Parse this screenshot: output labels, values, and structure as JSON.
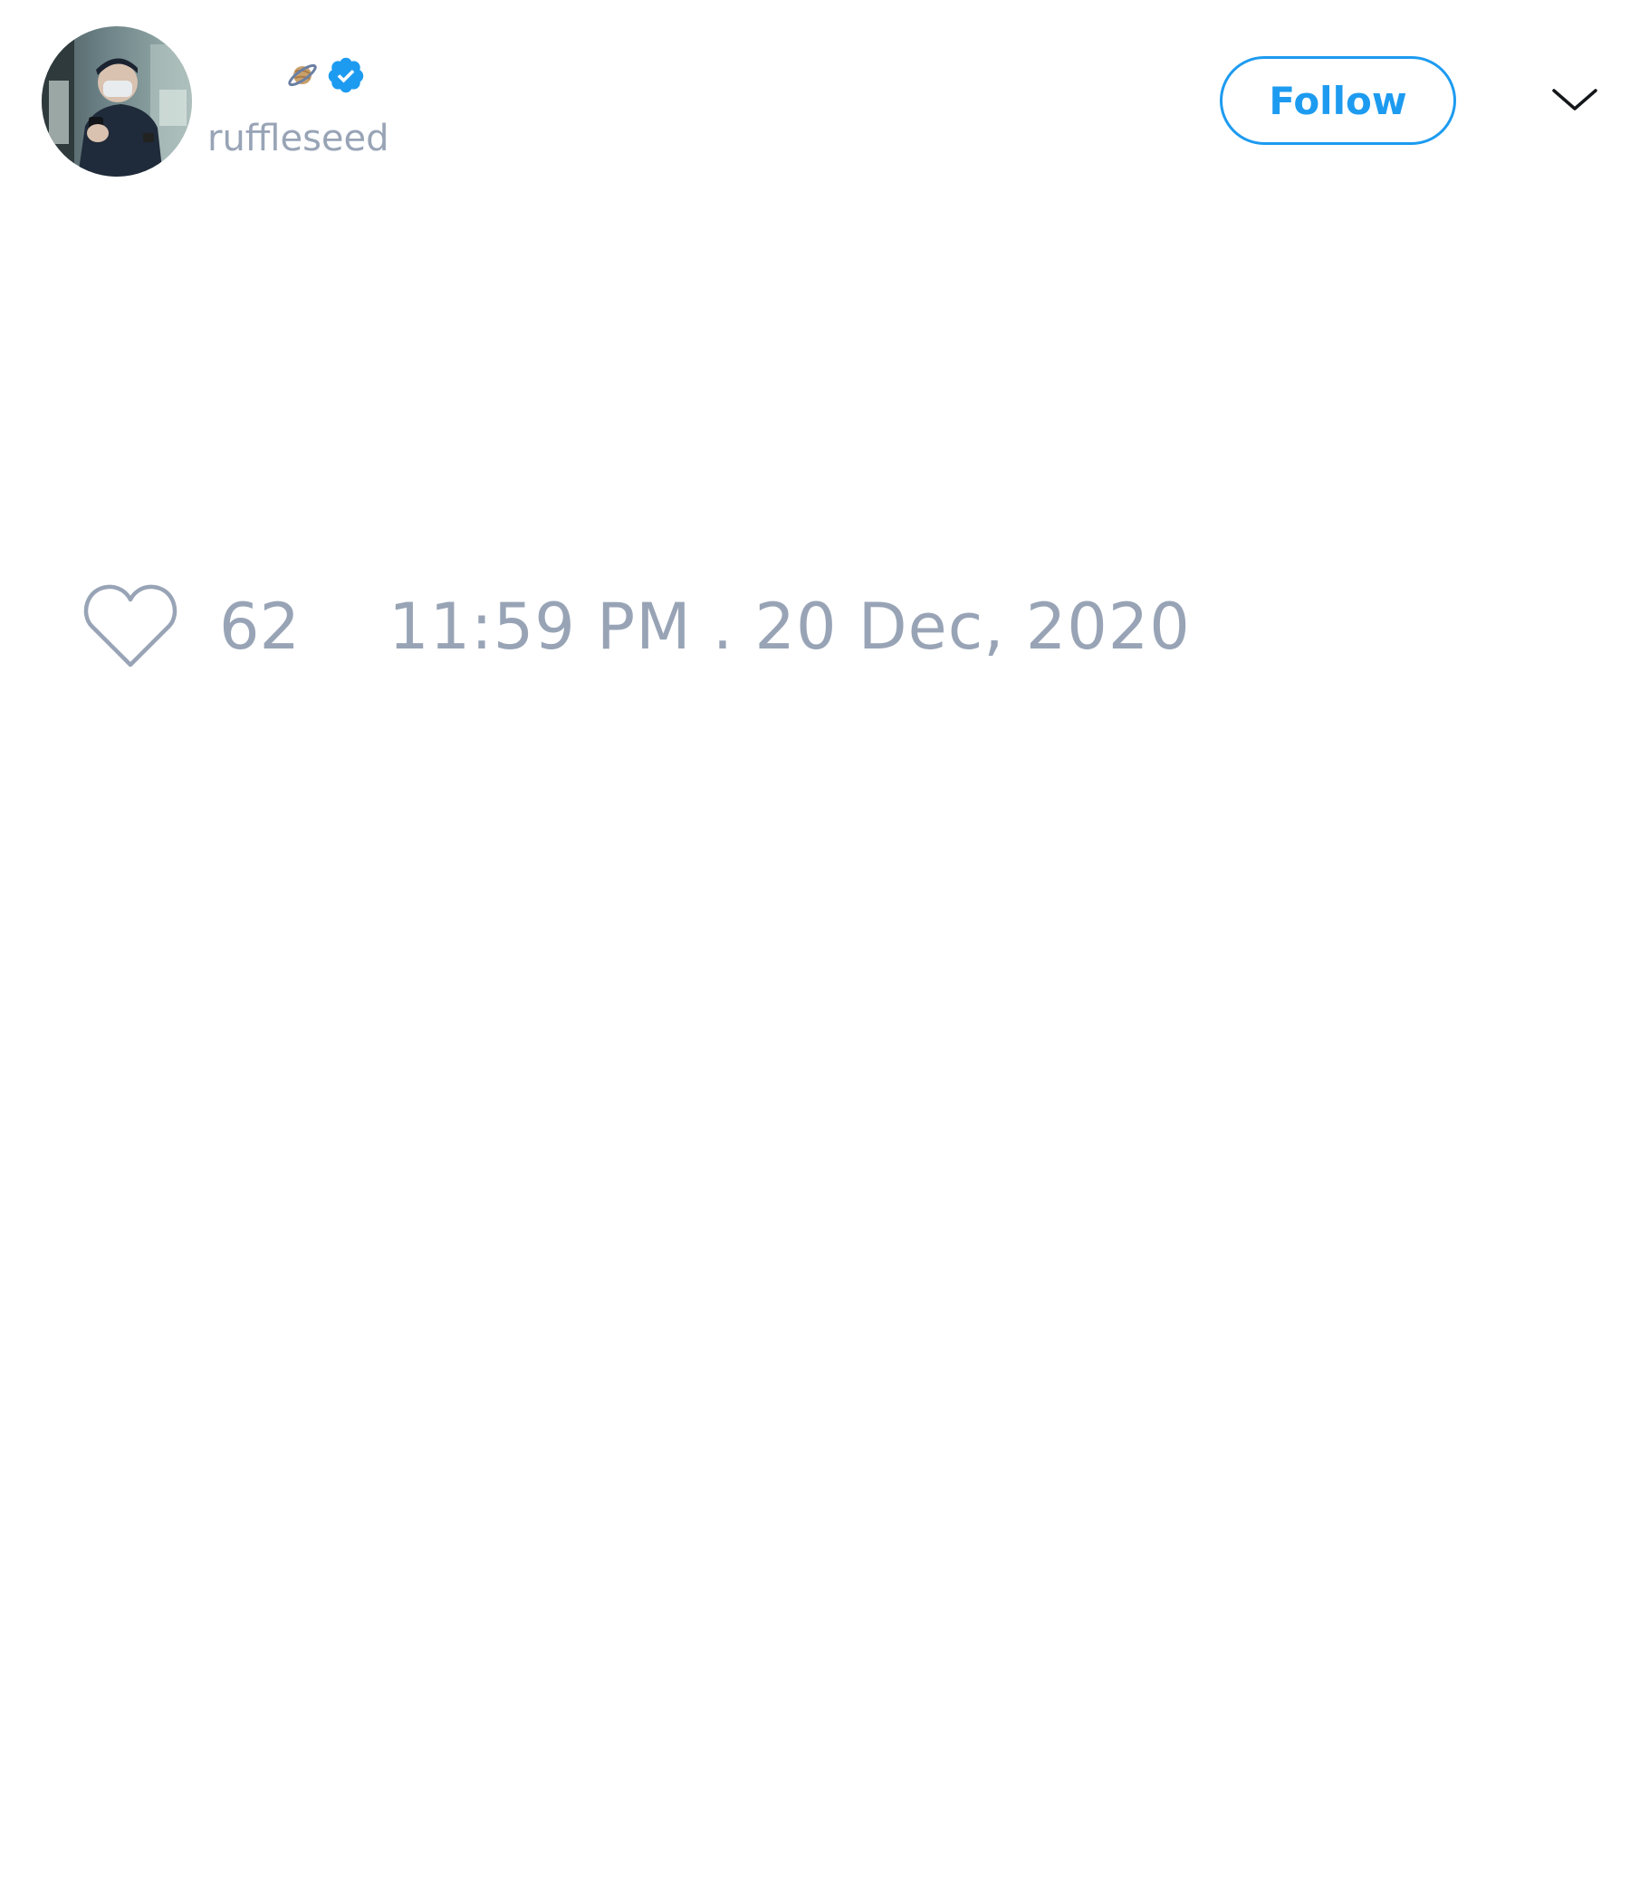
{
  "author": {
    "display_name": "",
    "name_icon": "ringed-planet-icon",
    "verified_icon": "verified-badge-icon",
    "handle": "ruffleseed",
    "avatar": "profile-photo"
  },
  "actions": {
    "follow_label": "Follow",
    "more_icon": "chevron-down-icon"
  },
  "footer": {
    "like_icon": "heart-outline-icon",
    "like_count": "62",
    "timestamp": "11:59 PM . 20 Dec, 2020"
  },
  "colors": {
    "accent": "#1d9bf0",
    "muted_text": "#98a4b6",
    "background": "#ffffff"
  }
}
